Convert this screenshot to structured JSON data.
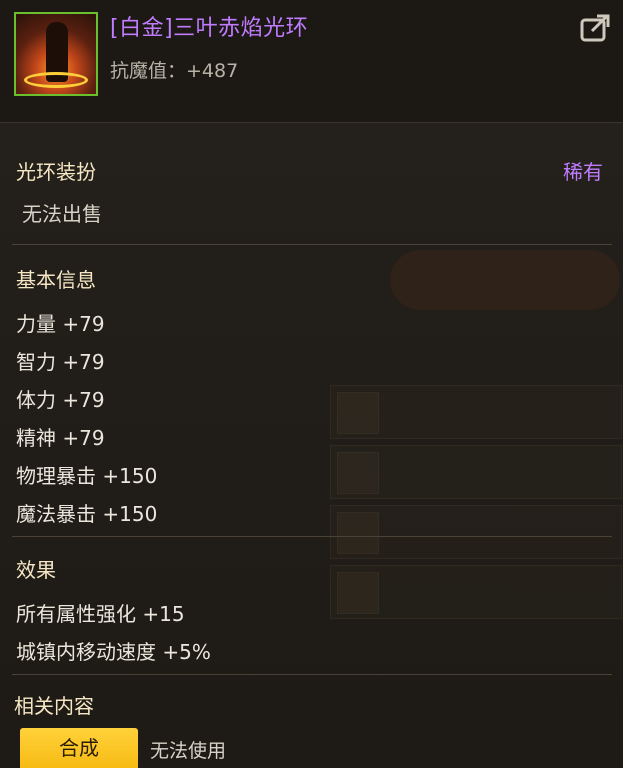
{
  "header": {
    "item_name": "[白金]三叶赤焰光环",
    "stat_line": "抗魔值：+487",
    "share_icon": "share-export-icon"
  },
  "category": {
    "title": "光环装扮",
    "rarity": "稀有",
    "sell_status": "无法出售"
  },
  "basic_info": {
    "title": "基本信息",
    "stats": [
      "力量 +79",
      "智力 +79",
      "体力 +79",
      "精神 +79",
      "物理暴击 +150",
      "魔法暴击 +150"
    ]
  },
  "effects": {
    "title": "效果",
    "lines": [
      "所有属性强化 +15",
      "城镇内移动速度 +5%"
    ]
  },
  "related": {
    "title": "相关内容",
    "synth_button": "合成",
    "status": "无法使用"
  },
  "colors": {
    "rarity_purple": "#c07cff",
    "icon_border_green": "#6cbf2c",
    "button_yellow": "#f7bb14"
  }
}
